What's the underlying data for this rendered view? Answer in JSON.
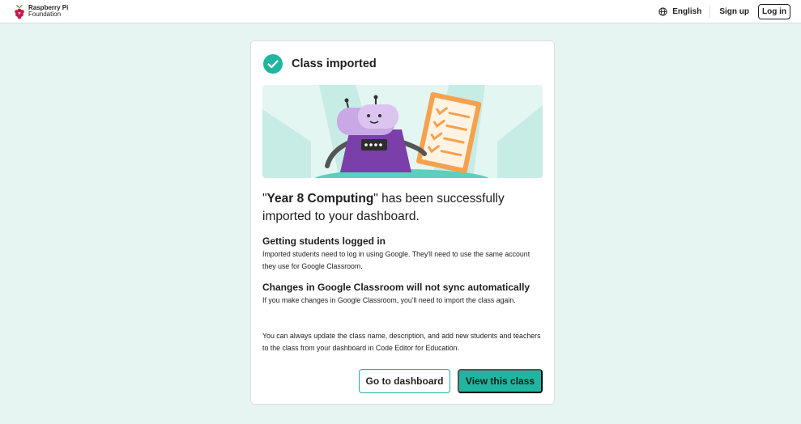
{
  "header": {
    "brand_line1": "Raspberry Pi",
    "brand_line2": "Foundation",
    "language": "English",
    "signup_label": "Sign up",
    "login_label": "Log in"
  },
  "card": {
    "title": "Class imported",
    "headline_open_quote": "\"",
    "class_name": "Year 8 Computing",
    "headline_rest": "\" has been successfully imported to your dashboard.",
    "section1_title": "Getting students logged in",
    "section1_body": "Imported students need to log in using Google. They'll need to use the same account they use for Google Classroom.",
    "section2_title": "Changes in Google Classroom will not sync automatically",
    "section2_body": "If you make changes in Google Classroom, you'll need to import the class again.",
    "footer_note": "You can always update the class name, description, and add new students and teachers to the class from your dashboard in Code Editor for Education.",
    "dashboard_button": "Go to dashboard",
    "view_class_button": "View this class"
  },
  "colors": {
    "accent": "#20b5a0",
    "page_bg": "#e6f5f2",
    "robot_purple": "#7a3fa8",
    "clipboard_orange": "#f5a14e"
  },
  "icons": [
    "raspberry-logo-icon",
    "globe-icon",
    "check-circle-icon"
  ]
}
